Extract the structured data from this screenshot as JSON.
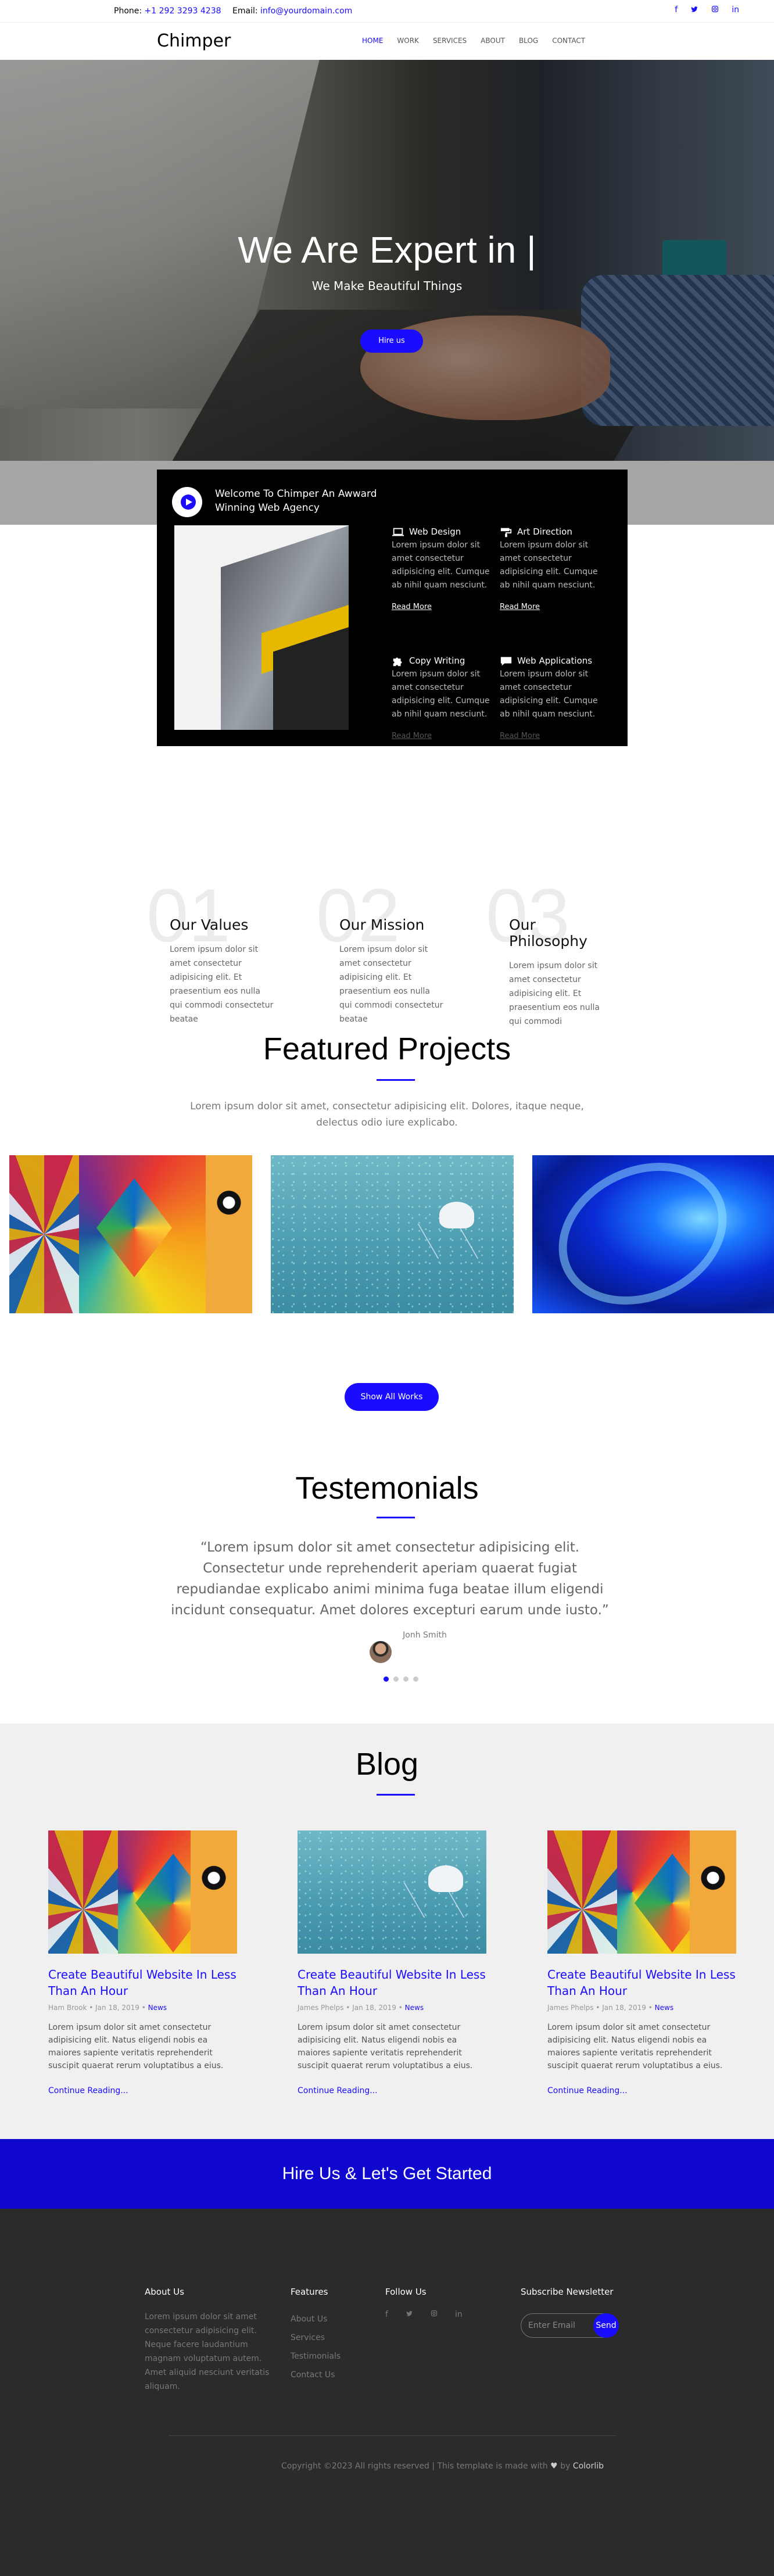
{
  "topbar": {
    "phone_label": "Phone:",
    "phone": "+1 292 3293 4238",
    "email_label": "Email:",
    "email": "info@yourdomain.com",
    "social": [
      "f",
      "t",
      "ig",
      "in"
    ]
  },
  "nav": {
    "logo": "Chimper",
    "items": [
      "HOME",
      "WORK",
      "SERVICES",
      "ABOUT",
      "BLOG",
      "CONTACT"
    ]
  },
  "hero": {
    "title": "We Are Expert in |",
    "subtitle": "We Make Beautiful Things",
    "button": "Hire us"
  },
  "welcome": {
    "title": "Welcome To Chimper An Awward Winning Web Agency",
    "features": [
      {
        "title": "Web Design",
        "icon": "laptop-icon",
        "text": "Lorem ipsum dolor sit amet consectetur adipisicing elit. Cumque ab nihil quam nesciunt.",
        "link": "Read More"
      },
      {
        "title": "Art Direction",
        "icon": "paint-roller-icon",
        "text": "Lorem ipsum dolor sit amet consectetur adipisicing elit. Cumque ab nihil quam nesciunt.",
        "link": "Read More"
      },
      {
        "title": "Copy Writing",
        "icon": "puzzle-icon",
        "text": "Lorem ipsum dolor sit amet consectetur adipisicing elit. Cumque ab nihil quam nesciunt.",
        "link": "Read More"
      },
      {
        "title": "Web Applications",
        "icon": "chat-bubble-icon",
        "text": "Lorem ipsum dolor sit amet consectetur adipisicing elit. Cumque ab nihil quam nesciunt.",
        "link": "Read More"
      }
    ]
  },
  "values": [
    {
      "num": "01",
      "title": "Our Values",
      "text": "Lorem ipsum dolor sit amet consectetur adipisicing elit. Et praesentium eos nulla qui commodi consectetur beatae"
    },
    {
      "num": "02",
      "title": "Our Mission",
      "text": "Lorem ipsum dolor sit amet consectetur adipisicing elit. Et praesentium eos nulla qui commodi consectetur beatae"
    },
    {
      "num": "03",
      "title": "Our Philosophy",
      "text": "Lorem ipsum dolor sit amet consectetur adipisicing elit. Et praesentium eos nulla qui commodi"
    }
  ],
  "featured": {
    "title": "Featured Projects",
    "desc": "Lorem ipsum dolor sit amet, consectetur adipisicing elit. Dolores, itaque neque, delectus odio iure explicabo.",
    "button": "Show All Works"
  },
  "testimonials": {
    "title": "Testemonials",
    "quote": "“Lorem ipsum dolor sit amet consectetur adipisicing elit. Consectetur unde reprehenderit aperiam quaerat fugiat repudiandae explicabo animi minima fuga beatae illum eligendi incidunt consequatur. Amet dolores excepturi earum unde iusto.”",
    "author": "Jonh Smith"
  },
  "blog": {
    "title": "Blog",
    "posts": [
      {
        "title": "Create Beautiful Website In Less Than An Hour",
        "author": "Ham Brook",
        "date": "Jan 18, 2019",
        "tag": "News",
        "text": "Lorem ipsum dolor sit amet consectetur adipisicing elit. Natus eligendi nobis ea maiores sapiente veritatis reprehenderit suscipit quaerat rerum voluptatibus a eius.",
        "link": "Continue Reading..."
      },
      {
        "title": "Create Beautiful Website In Less Than An Hour",
        "author": "James Phelps",
        "date": "Jan 18, 2019",
        "tag": "News",
        "text": "Lorem ipsum dolor sit amet consectetur adipisicing elit. Natus eligendi nobis ea maiores sapiente veritatis reprehenderit suscipit quaerat rerum voluptatibus a eius.",
        "link": "Continue Reading..."
      },
      {
        "title": "Create Beautiful Website In Less Than An Hour",
        "author": "James Phelps",
        "date": "Jan 18, 2019",
        "tag": "News",
        "text": "Lorem ipsum dolor sit amet consectetur adipisicing elit. Natus eligendi nobis ea maiores sapiente veritatis reprehenderit suscipit quaerat rerum voluptatibus a eius.",
        "link": "Continue Reading..."
      }
    ]
  },
  "hireband": "Hire Us & Let's Get Started",
  "footer": {
    "about_title": "About Us",
    "about_text": "Lorem ipsum dolor sit amet consectetur adipisicing elit. Neque facere laudantium magnam voluptatum autem. Amet aliquid nesciunt veritatis aliquam.",
    "features_title": "Features",
    "features": [
      "About Us",
      "Services",
      "Testimonials",
      "Contact Us"
    ],
    "follow_title": "Follow Us",
    "follow": [
      "f",
      "t",
      "ig",
      "in"
    ],
    "newsletter_title": "Subscribe Newsletter",
    "newsletter_placeholder": "Enter Email",
    "send": "Send",
    "copyright": "Copyright ©2023 All rights reserved | This template is made with",
    "by": "by",
    "credit": "Colorlib"
  }
}
